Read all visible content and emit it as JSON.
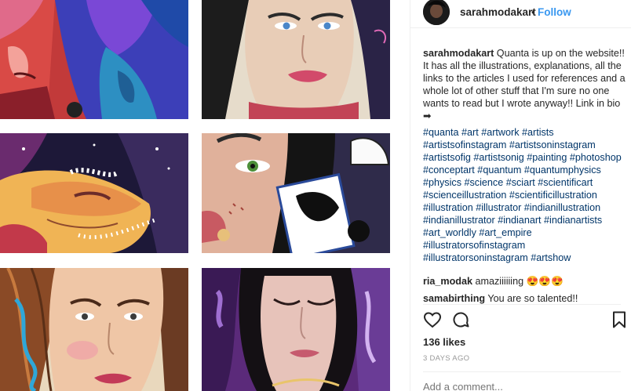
{
  "post": {
    "username": "sarahmodakart",
    "separator": "•",
    "follow_label": "Follow",
    "caption": {
      "user": "sarahmodakart",
      "text": "Quanta is up on the website!! It has all the illustrations, explanations, all the links to the articles I used for references and a whole lot of other stuff that I'm sure no one wants to read but I wrote anyway!! Link in bio ➡",
      "hashtags": "#quanta #art #artwork #artists #artistsofinstagram #artistsoninstagram #artistsofig #artistsonig #painting #photoshop #conceptart #quantum #quantumphysics #physics #science #sciart #scientificart #scienceillustration #scientificillustration #illustration #illustrator #indianillustration #indianillustrator #indianart #indianartists #art_worldly #art_empire #illustratorsofinstagram #illustratorsoninstagram #artshow"
    },
    "comments": [
      {
        "user": "ria_modak",
        "text": "amaziiiiiing 😍😍😍"
      },
      {
        "user": "samabirthing",
        "text": "You are so talented!!"
      }
    ],
    "likes": "136 likes",
    "time": "3 DAYS AGO",
    "add_comment_placeholder": "Add a comment..."
  },
  "icons": {
    "like": "heart-icon",
    "comment": "comment-icon",
    "save": "bookmark-icon"
  }
}
